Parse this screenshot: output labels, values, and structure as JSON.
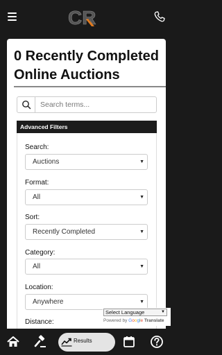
{
  "header": {
    "logo_text": "CR",
    "menu_icon": "hamburger-icon",
    "phone_icon": "phone-icon"
  },
  "main": {
    "title": "0 Recently Completed Online Auctions",
    "search": {
      "placeholder": "Search terms...",
      "value": ""
    },
    "filters_title": "Advanced Filters",
    "filters": [
      {
        "label": "Search:",
        "value": "Auctions"
      },
      {
        "label": "Format:",
        "value": "All"
      },
      {
        "label": "Sort:",
        "value": "Recently Completed"
      },
      {
        "label": "Category:",
        "value": "All"
      },
      {
        "label": "Location:",
        "value": "Anywhere"
      },
      {
        "label": "Distance:",
        "value": ""
      }
    ]
  },
  "translate": {
    "select_label": "Select Language",
    "powered_by": "Powered by",
    "google": [
      "G",
      "o",
      "o",
      "g",
      "l",
      "e"
    ],
    "translate": "Translate"
  },
  "bottom_nav": {
    "results_label": "Results",
    "icons": [
      "home-icon",
      "gavel-icon",
      "results-chart-icon",
      "calendar-icon",
      "help-icon"
    ]
  },
  "colors": {
    "header_bg": "#1a1a1a",
    "logo_accent": "#e07a1f"
  }
}
